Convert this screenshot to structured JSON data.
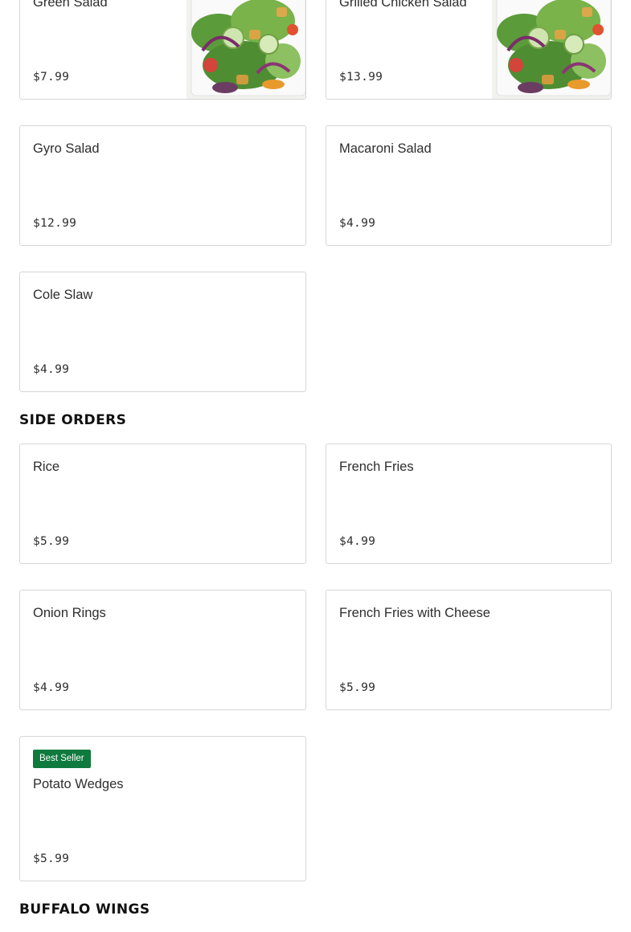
{
  "salads": {
    "items": [
      {
        "name": "Green Salad",
        "price": "$7.99",
        "image": "salad-photo"
      },
      {
        "name": "Grilled Chicken Salad",
        "price": "$13.99",
        "image": "salad-photo"
      },
      {
        "name": "Gyro Salad",
        "price": "$12.99"
      },
      {
        "name": "Macaroni Salad",
        "price": "$4.99"
      },
      {
        "name": "Cole Slaw",
        "price": "$4.99"
      }
    ]
  },
  "side_orders": {
    "title": "SIDE ORDERS",
    "items": [
      {
        "name": "Rice",
        "price": "$5.99"
      },
      {
        "name": "French Fries",
        "price": "$4.99"
      },
      {
        "name": "Onion Rings",
        "price": "$4.99"
      },
      {
        "name": "French Fries with Cheese",
        "price": "$5.99"
      },
      {
        "name": "Potato Wedges",
        "price": "$5.99",
        "badge": "Best Seller"
      }
    ]
  },
  "buffalo_wings": {
    "title": "BUFFALO WINGS"
  },
  "colors": {
    "badge_green": "#0f7a3d",
    "card_border": "#d6d6d6",
    "text": "#2e2e2e"
  }
}
